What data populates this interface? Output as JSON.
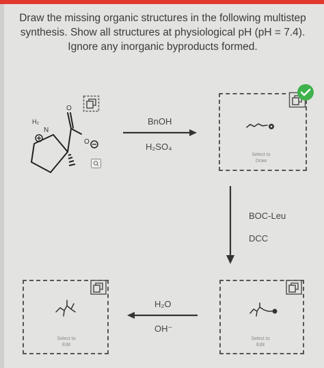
{
  "instructions": {
    "line1": "Draw the missing organic structures in the following multistep",
    "line2": "synthesis. Show all structures at physiological pH (pH = 7.4).",
    "line3": "Ignore any inorganic byproducts formed."
  },
  "molecule": {
    "h2_label": "H₂",
    "n_label": "N",
    "o_carbonyl": "O",
    "o_minus": "O"
  },
  "step1": {
    "reagent_top": "BnOH",
    "reagent_bottom": "H₂SO₄"
  },
  "step2": {
    "reagent_top": "BOC-Leu",
    "reagent_bottom": "DCC"
  },
  "step3": {
    "reagent_top": "H₂O",
    "reagent_bottom": "OH⁻"
  },
  "box1": {
    "hint_line1": "Select to",
    "hint_line2": "Draw"
  },
  "box2": {
    "hint_line1": "Select to",
    "hint_line2": "Edit"
  },
  "box3": {
    "hint_line1": "Select to",
    "hint_line2": "Edit"
  },
  "colors": {
    "accent_red": "#e2392f",
    "check_green": "#3fb24b",
    "panel_bg": "#e3e3e1"
  },
  "icons": [
    "copy-icon",
    "zoom-icon",
    "checkmark-icon"
  ]
}
